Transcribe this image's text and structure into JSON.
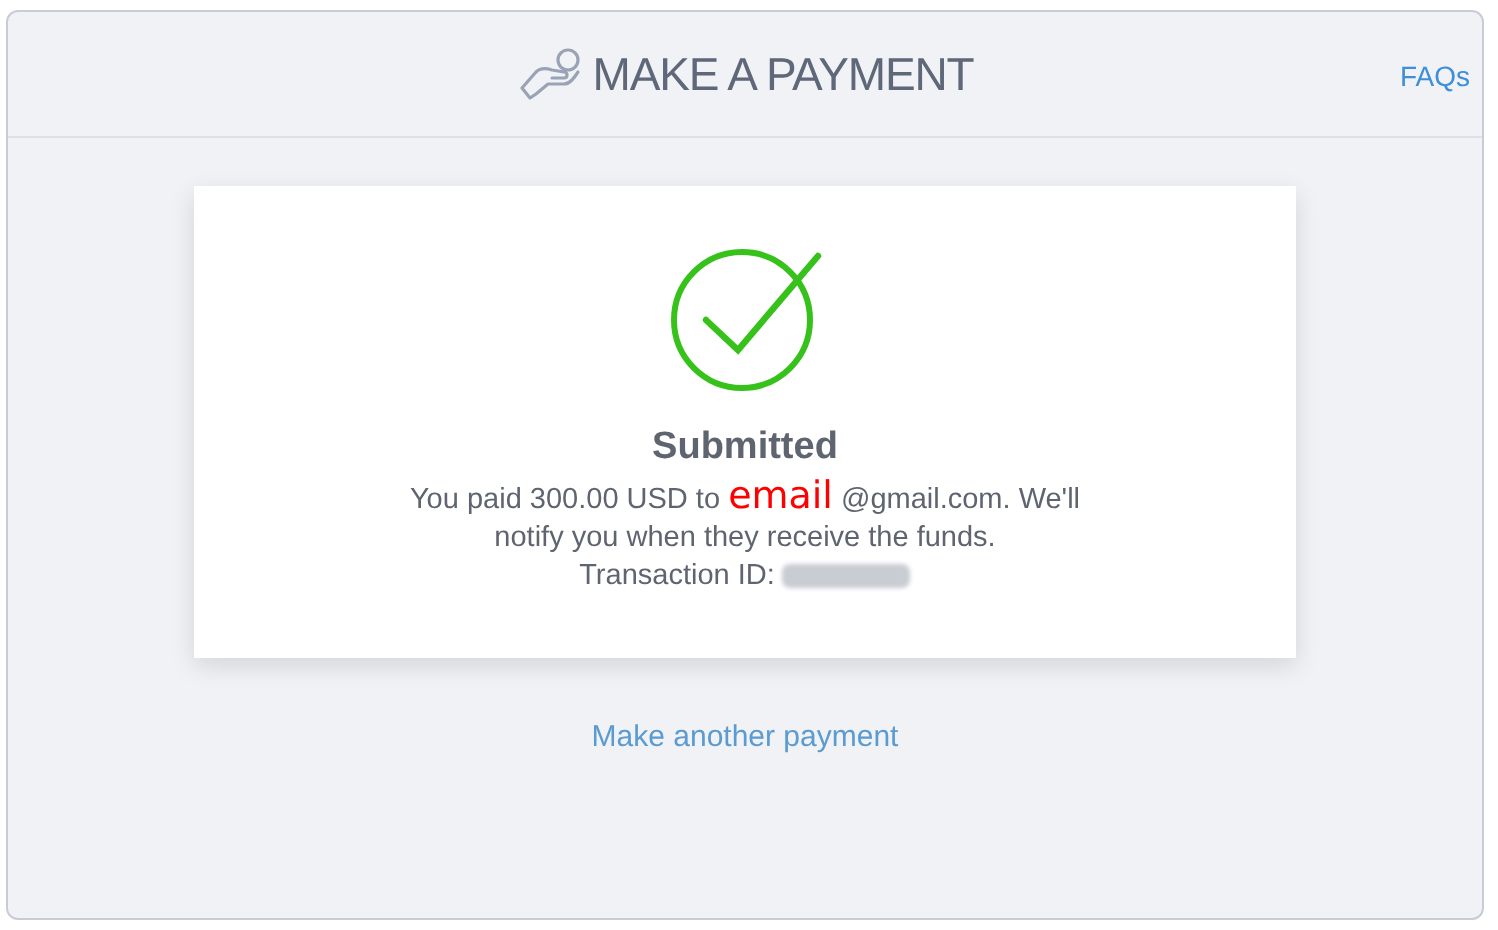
{
  "header": {
    "title": "MAKE A PAYMENT",
    "link": "FAQs"
  },
  "result": {
    "status": "Submitted",
    "message_before": "You paid 300.00 USD to ",
    "redaction_label": "email",
    "message_after": "@gmail.com. We'll notify you when they receive the funds.",
    "transaction_label": "Transaction ID:"
  },
  "action_link": "Make another payment"
}
